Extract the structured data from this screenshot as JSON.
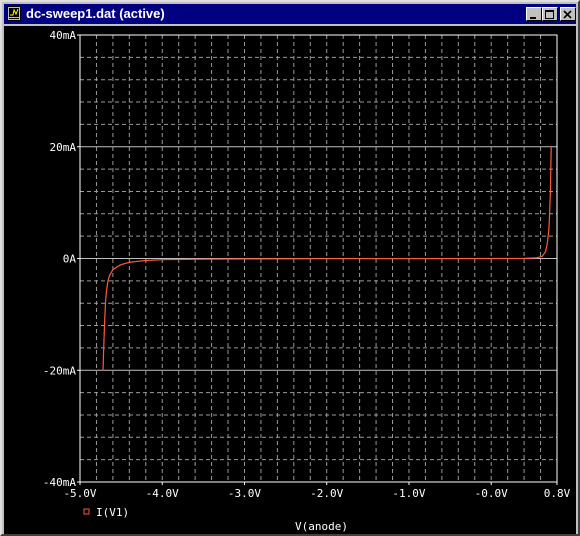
{
  "window": {
    "title": "dc-sweep1.dat (active)"
  },
  "colors": {
    "background": "#000000",
    "axis": "#ffffff",
    "trace": "#ff5a3c",
    "title_bar": "#000080"
  },
  "chart_data": {
    "type": "line",
    "xlabel": "V(anode)",
    "ylabel": "",
    "xlim": [
      -5.0,
      0.8
    ],
    "ylim": [
      -40,
      40
    ],
    "x_ticks": [
      {
        "v": -5.0,
        "label": "-5.0V"
      },
      {
        "v": -4.0,
        "label": "-4.0V"
      },
      {
        "v": -3.0,
        "label": "-3.0V"
      },
      {
        "v": -2.0,
        "label": "-2.0V"
      },
      {
        "v": -1.0,
        "label": "-1.0V"
      },
      {
        "v": 0.0,
        "label": "-0.0V"
      },
      {
        "v": 0.8,
        "label": "0.8V"
      }
    ],
    "y_ticks": [
      {
        "v": 40,
        "label": "40mA"
      },
      {
        "v": 20,
        "label": "20mA"
      },
      {
        "v": 0,
        "label": "0A"
      },
      {
        "v": -20,
        "label": "-20mA"
      },
      {
        "v": -40,
        "label": "-40mA"
      }
    ],
    "grid": true,
    "legend_position": "bottom-left",
    "series": [
      {
        "name": "I(V1)",
        "x": [
          -4.72,
          -4.71,
          -4.7,
          -4.69,
          -4.68,
          -4.66,
          -4.64,
          -4.6,
          -4.55,
          -4.5,
          -4.4,
          -4.3,
          -4.2,
          -4.0,
          -3.5,
          -3.0,
          -2.0,
          -1.0,
          0.0,
          0.4,
          0.55,
          0.62,
          0.66,
          0.68,
          0.7,
          0.71,
          0.72,
          0.725,
          0.73
        ],
        "y": [
          -20,
          -15,
          -11,
          -8,
          -6,
          -4,
          -3,
          -2,
          -1.5,
          -1.1,
          -0.7,
          -0.5,
          -0.35,
          -0.22,
          -0.12,
          -0.08,
          -0.04,
          -0.01,
          0,
          0.02,
          0.1,
          0.4,
          1.2,
          2.5,
          5,
          8,
          12,
          16,
          20
        ]
      }
    ]
  }
}
